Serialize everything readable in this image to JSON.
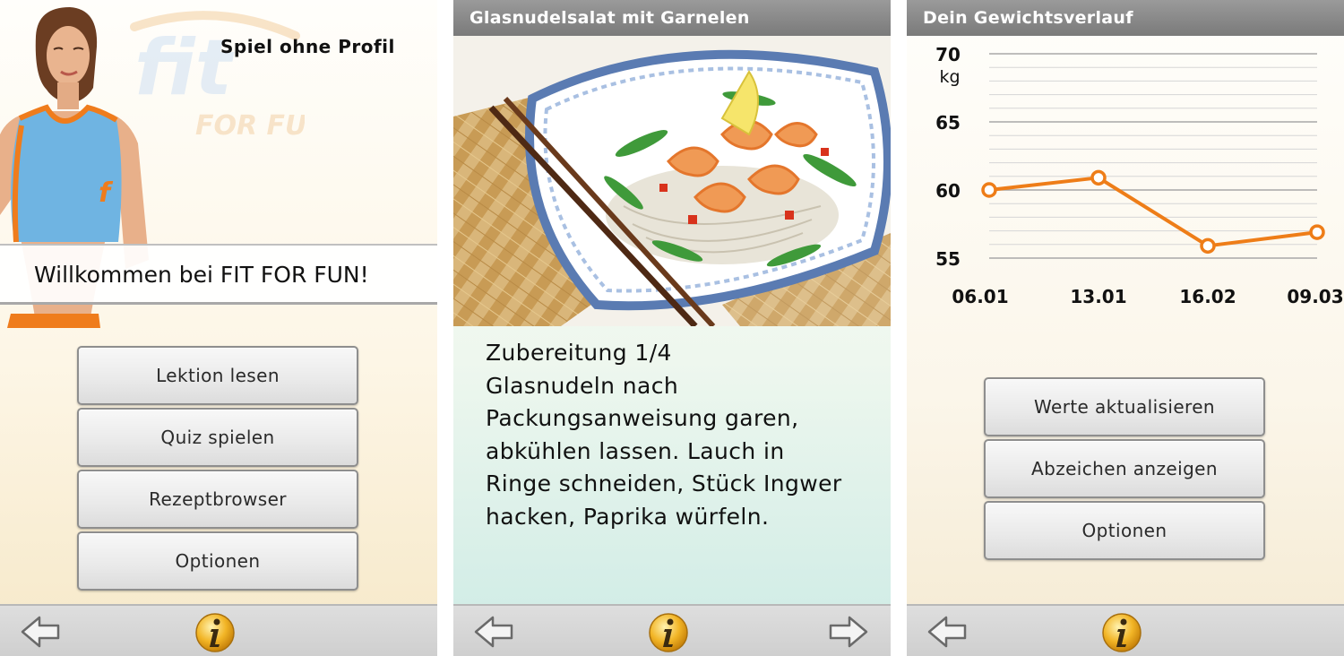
{
  "screen1": {
    "profile_label": "Spiel ohne Profil",
    "logo_text": "fit FOR FUN",
    "welcome_text": "Willkommen bei FIT FOR FUN!",
    "buttons": [
      {
        "label": "Lektion lesen"
      },
      {
        "label": "Quiz spielen"
      },
      {
        "label": "Rezeptbrowser"
      },
      {
        "label": "Optionen"
      }
    ],
    "nav": {
      "back_icon": "left-arrow-icon",
      "info_icon": "info-icon"
    }
  },
  "screen2": {
    "title": "Glasnudelsalat mit Garnelen",
    "step_label": "Zubereitung 1/4",
    "instruction_lines": [
      "Glasnudeln nach",
      "Packungsanweisung garen,",
      "abkühlen lassen. Lauch in",
      "Ringe schneiden, Stück Ingwer",
      "hacken, Paprika würfeln."
    ],
    "nav": {
      "back_icon": "left-arrow-icon",
      "info_icon": "info-icon",
      "next_icon": "right-arrow-icon"
    }
  },
  "screen3": {
    "title": "Dein Gewichtsverlauf",
    "buttons": [
      {
        "label": "Werte aktualisieren"
      },
      {
        "label": "Abzeichen anzeigen"
      },
      {
        "label": "Optionen"
      }
    ],
    "nav": {
      "back_icon": "left-arrow-icon",
      "info_icon": "info-icon"
    }
  },
  "chart_data": {
    "type": "line",
    "title": "",
    "xlabel": "",
    "ylabel": "kg",
    "categories": [
      "06.01",
      "13.01",
      "16.02",
      "09.03"
    ],
    "values": [
      60,
      60.9,
      55.9,
      56.9
    ],
    "ylim": [
      55,
      70
    ],
    "yticks": [
      55,
      60,
      65,
      70
    ],
    "ytick_labels": [
      "55",
      "60",
      "65",
      "70"
    ],
    "grid": true,
    "line_color": "#ee7d18"
  },
  "colors": {
    "accent_orange": "#ee7d18",
    "titlebar": "#8a8a8a",
    "info_gold": "#f2b526"
  }
}
